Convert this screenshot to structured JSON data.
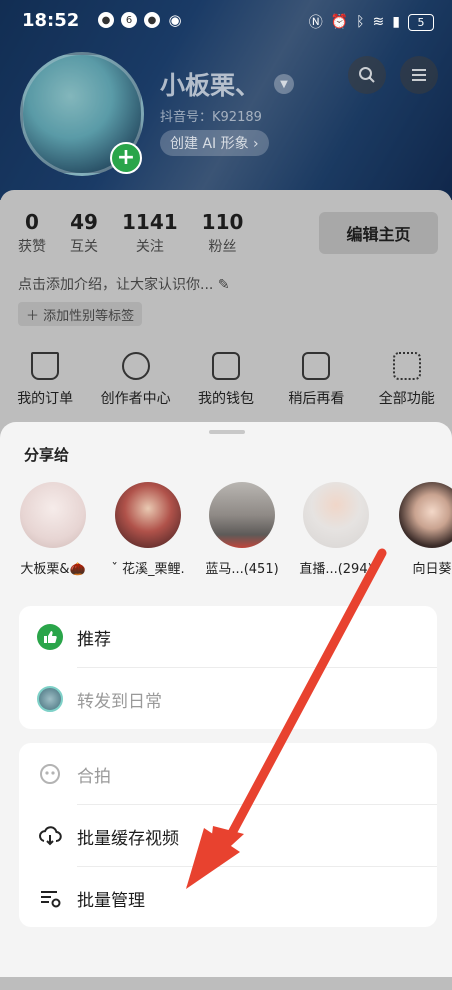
{
  "status_bar": {
    "time": "18:52",
    "battery": "5"
  },
  "profile": {
    "username": "小板栗、",
    "douyin_id": "抖音号：K92189",
    "ai_button": "创建 AI 形象 ›",
    "stats": [
      {
        "num": "0",
        "label": "获赞"
      },
      {
        "num": "49",
        "label": "互关"
      },
      {
        "num": "1141",
        "label": "关注"
      },
      {
        "num": "110",
        "label": "粉丝"
      }
    ],
    "edit_button": "编辑主页",
    "intro": "点击添加介绍，让大家认识你...",
    "gender_tag": "＋ 添加性别等标签",
    "quick_actions": [
      "我的订单",
      "创作者中心",
      "我的钱包",
      "稍后再看",
      "全部功能"
    ]
  },
  "share_sheet": {
    "title": "分享给",
    "contacts": [
      {
        "name": "大板栗&🌰",
        "color": "#e7d5d3"
      },
      {
        "name": "ˇ 花溪_栗鲤.",
        "color": "#7a3a38"
      },
      {
        "name": "蓝马...(451)",
        "color": "#8f8a86"
      },
      {
        "name": "直播...(294)",
        "color": "#d7d4d2"
      },
      {
        "name": "向日葵",
        "color": "#3a2b28"
      }
    ],
    "group1": [
      {
        "label": "推荐",
        "icon": "thumbs-up-icon",
        "dim": false
      },
      {
        "label": "转发到日常",
        "icon": "daily-avatar-icon",
        "dim": true
      }
    ],
    "group2": [
      {
        "label": "合拍",
        "icon": "duet-icon",
        "dim": true
      },
      {
        "label": "批量缓存视频",
        "icon": "download-cloud-icon",
        "dim": false
      },
      {
        "label": "批量管理",
        "icon": "batch-manage-icon",
        "dim": false
      }
    ]
  },
  "colors": {
    "accent_green": "#2aa54a",
    "arrow_red": "#e8422f"
  }
}
